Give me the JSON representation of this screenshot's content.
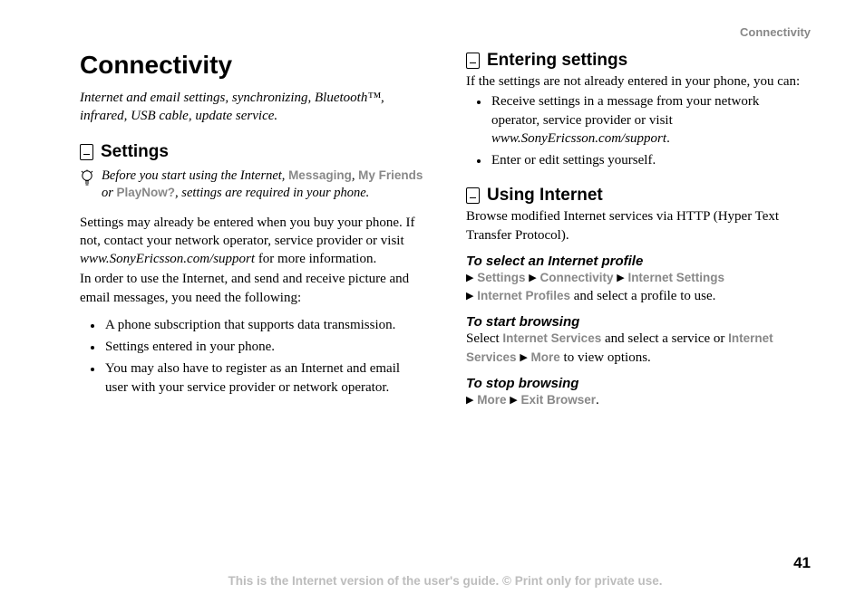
{
  "running_head": "Connectivity",
  "left": {
    "chapter_title": "Connectivity",
    "chapter_sub": "Internet and email settings, synchronizing, Bluetooth™, infrared, USB cable, update service.",
    "section_settings": "Settings",
    "tip_pre": "Before you start using the Internet, ",
    "tip_ui1": "Messaging",
    "tip_mid1": ", ",
    "tip_ui2": "My Friends",
    "tip_mid2": " or ",
    "tip_ui3": "PlayNow?",
    "tip_post": ", settings are required in your phone.",
    "para1_a": "Settings may already be entered when you buy your phone. If not, contact your network operator, service provider or visit ",
    "para1_site": "www.SonyEricsson.com/support",
    "para1_b": " for more information.",
    "para2": "In order to use the Internet, and send and receive picture and email messages, you need the following:",
    "bullets": [
      "A phone subscription that supports data transmission.",
      "Settings entered in your phone.",
      "You may also have to register as an Internet and email user with your service provider or network operator."
    ]
  },
  "right": {
    "section_entering": "Entering settings",
    "entering_lead": "If the settings are not already entered in your phone, you can:",
    "entering_b1_a": "Receive settings in a message from your network operator, service provider or visit ",
    "entering_b1_site": "www.SonyEricsson.com/support",
    "entering_b1_b": ".",
    "entering_b2": "Enter or edit settings yourself.",
    "section_using": "Using Internet",
    "using_lead": "Browse modified Internet services via HTTP (Hyper Text Transfer Protocol).",
    "task_select": "To select an Internet profile",
    "sel_u1": "Settings",
    "sel_u2": "Connectivity",
    "sel_u3": "Internet Settings",
    "sel_u4": "Internet Profiles",
    "sel_tail": " and select a profile to use.",
    "task_start": "To start browsing",
    "start_a": "Select ",
    "start_u1": "Internet Services",
    "start_mid": " and select a service or ",
    "start_u2": "Internet Services",
    "start_u3": "More",
    "start_tail": " to view options.",
    "task_stop": "To stop browsing",
    "stop_u1": "More",
    "stop_u2": "Exit Browser",
    "stop_tail": "."
  },
  "footer": {
    "pagenum": "41",
    "line": "This is the Internet version of the user's guide. © Print only for private use."
  }
}
